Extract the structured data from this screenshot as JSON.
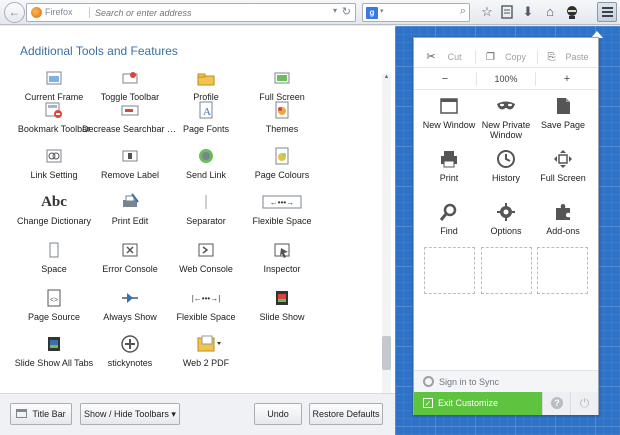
{
  "toolbar": {
    "url_brand": "Firefox",
    "url_placeholder": "Search or enter address",
    "search_engine": "g",
    "icons": [
      "back-icon",
      "forward-icon",
      "reload-icon",
      "search-icon",
      "bookmark-star-icon",
      "reading-list-icon",
      "download-icon",
      "home-icon",
      "ninja-icon",
      "hamburger-menu-icon"
    ]
  },
  "palette": {
    "title": "Additional Tools and Features",
    "items": [
      {
        "label": "Current Frame",
        "icon": "frame-icon"
      },
      {
        "label": "Toggle Toolbar",
        "icon": "toggle-toolbar-icon"
      },
      {
        "label": "Profile",
        "icon": "profile-icon"
      },
      {
        "label": "Full Screen",
        "icon": "fullscreen-icon"
      },
      {
        "label": "Bookmark Toolbar",
        "icon": "bookmark-toolbar-icon"
      },
      {
        "label": "Decrease Searchbar Size",
        "icon": "decrease-searchbar-icon"
      },
      {
        "label": "Page Fonts",
        "icon": "page-fonts-icon"
      },
      {
        "label": "Themes",
        "icon": "themes-icon"
      },
      {
        "label": "Link Setting",
        "icon": "link-setting-icon"
      },
      {
        "label": "Remove Label",
        "icon": "remove-label-icon"
      },
      {
        "label": "Send Link",
        "icon": "send-link-icon"
      },
      {
        "label": "Page Colours",
        "icon": "page-colours-icon"
      },
      {
        "label": "Change Dictionary",
        "icon": "dictionary-icon",
        "glyph": "Abc"
      },
      {
        "label": "Print Edit",
        "icon": "print-edit-icon"
      },
      {
        "label": "Separator",
        "icon": "separator-icon"
      },
      {
        "label": "Flexible Space",
        "icon": "flexible-space-icon"
      },
      {
        "label": "Space",
        "icon": "space-icon"
      },
      {
        "label": "Error Console",
        "icon": "error-console-icon"
      },
      {
        "label": "Web Console",
        "icon": "web-console-icon"
      },
      {
        "label": "Inspector",
        "icon": "inspector-icon"
      },
      {
        "label": "Page Source",
        "icon": "page-source-icon"
      },
      {
        "label": "Always Show",
        "icon": "always-show-icon"
      },
      {
        "label": "Flexible Space",
        "icon": "flexible-space-icon"
      },
      {
        "label": "Slide Show",
        "icon": "slide-show-icon"
      },
      {
        "label": "Slide Show All Tabs",
        "icon": "slide-show-all-icon"
      },
      {
        "label": "stickynotes",
        "icon": "stickynotes-icon"
      },
      {
        "label": "Web 2 PDF",
        "icon": "web2pdf-icon"
      }
    ]
  },
  "bottom_bar": {
    "title_bar": "Title Bar",
    "show_hide_toolbars": "Show / Hide Toolbars",
    "undo": "Undo",
    "restore_defaults": "Restore Defaults"
  },
  "menu": {
    "cut": "Cut",
    "copy": "Copy",
    "paste": "Paste",
    "zoom_out": "−",
    "zoom_level": "100%",
    "zoom_in": "+",
    "items": [
      {
        "label": "New Window",
        "icon": "new-window-icon"
      },
      {
        "label": "New Private Window",
        "icon": "private-window-icon"
      },
      {
        "label": "Save Page",
        "icon": "save-page-icon"
      },
      {
        "label": "Print",
        "icon": "print-icon"
      },
      {
        "label": "History",
        "icon": "history-icon"
      },
      {
        "label": "Full Screen",
        "icon": "fullscreen-icon"
      },
      {
        "label": "Find",
        "icon": "find-icon"
      },
      {
        "label": "Options",
        "icon": "options-icon"
      },
      {
        "label": "Add-ons",
        "icon": "addons-icon"
      }
    ],
    "sync": "Sign in to Sync",
    "exit_customize": "Exit Customize",
    "help": "?"
  },
  "colors": {
    "accent_blue": "#2f73c9",
    "exit_green": "#5ec440",
    "title_blue": "#3e6fa3"
  }
}
